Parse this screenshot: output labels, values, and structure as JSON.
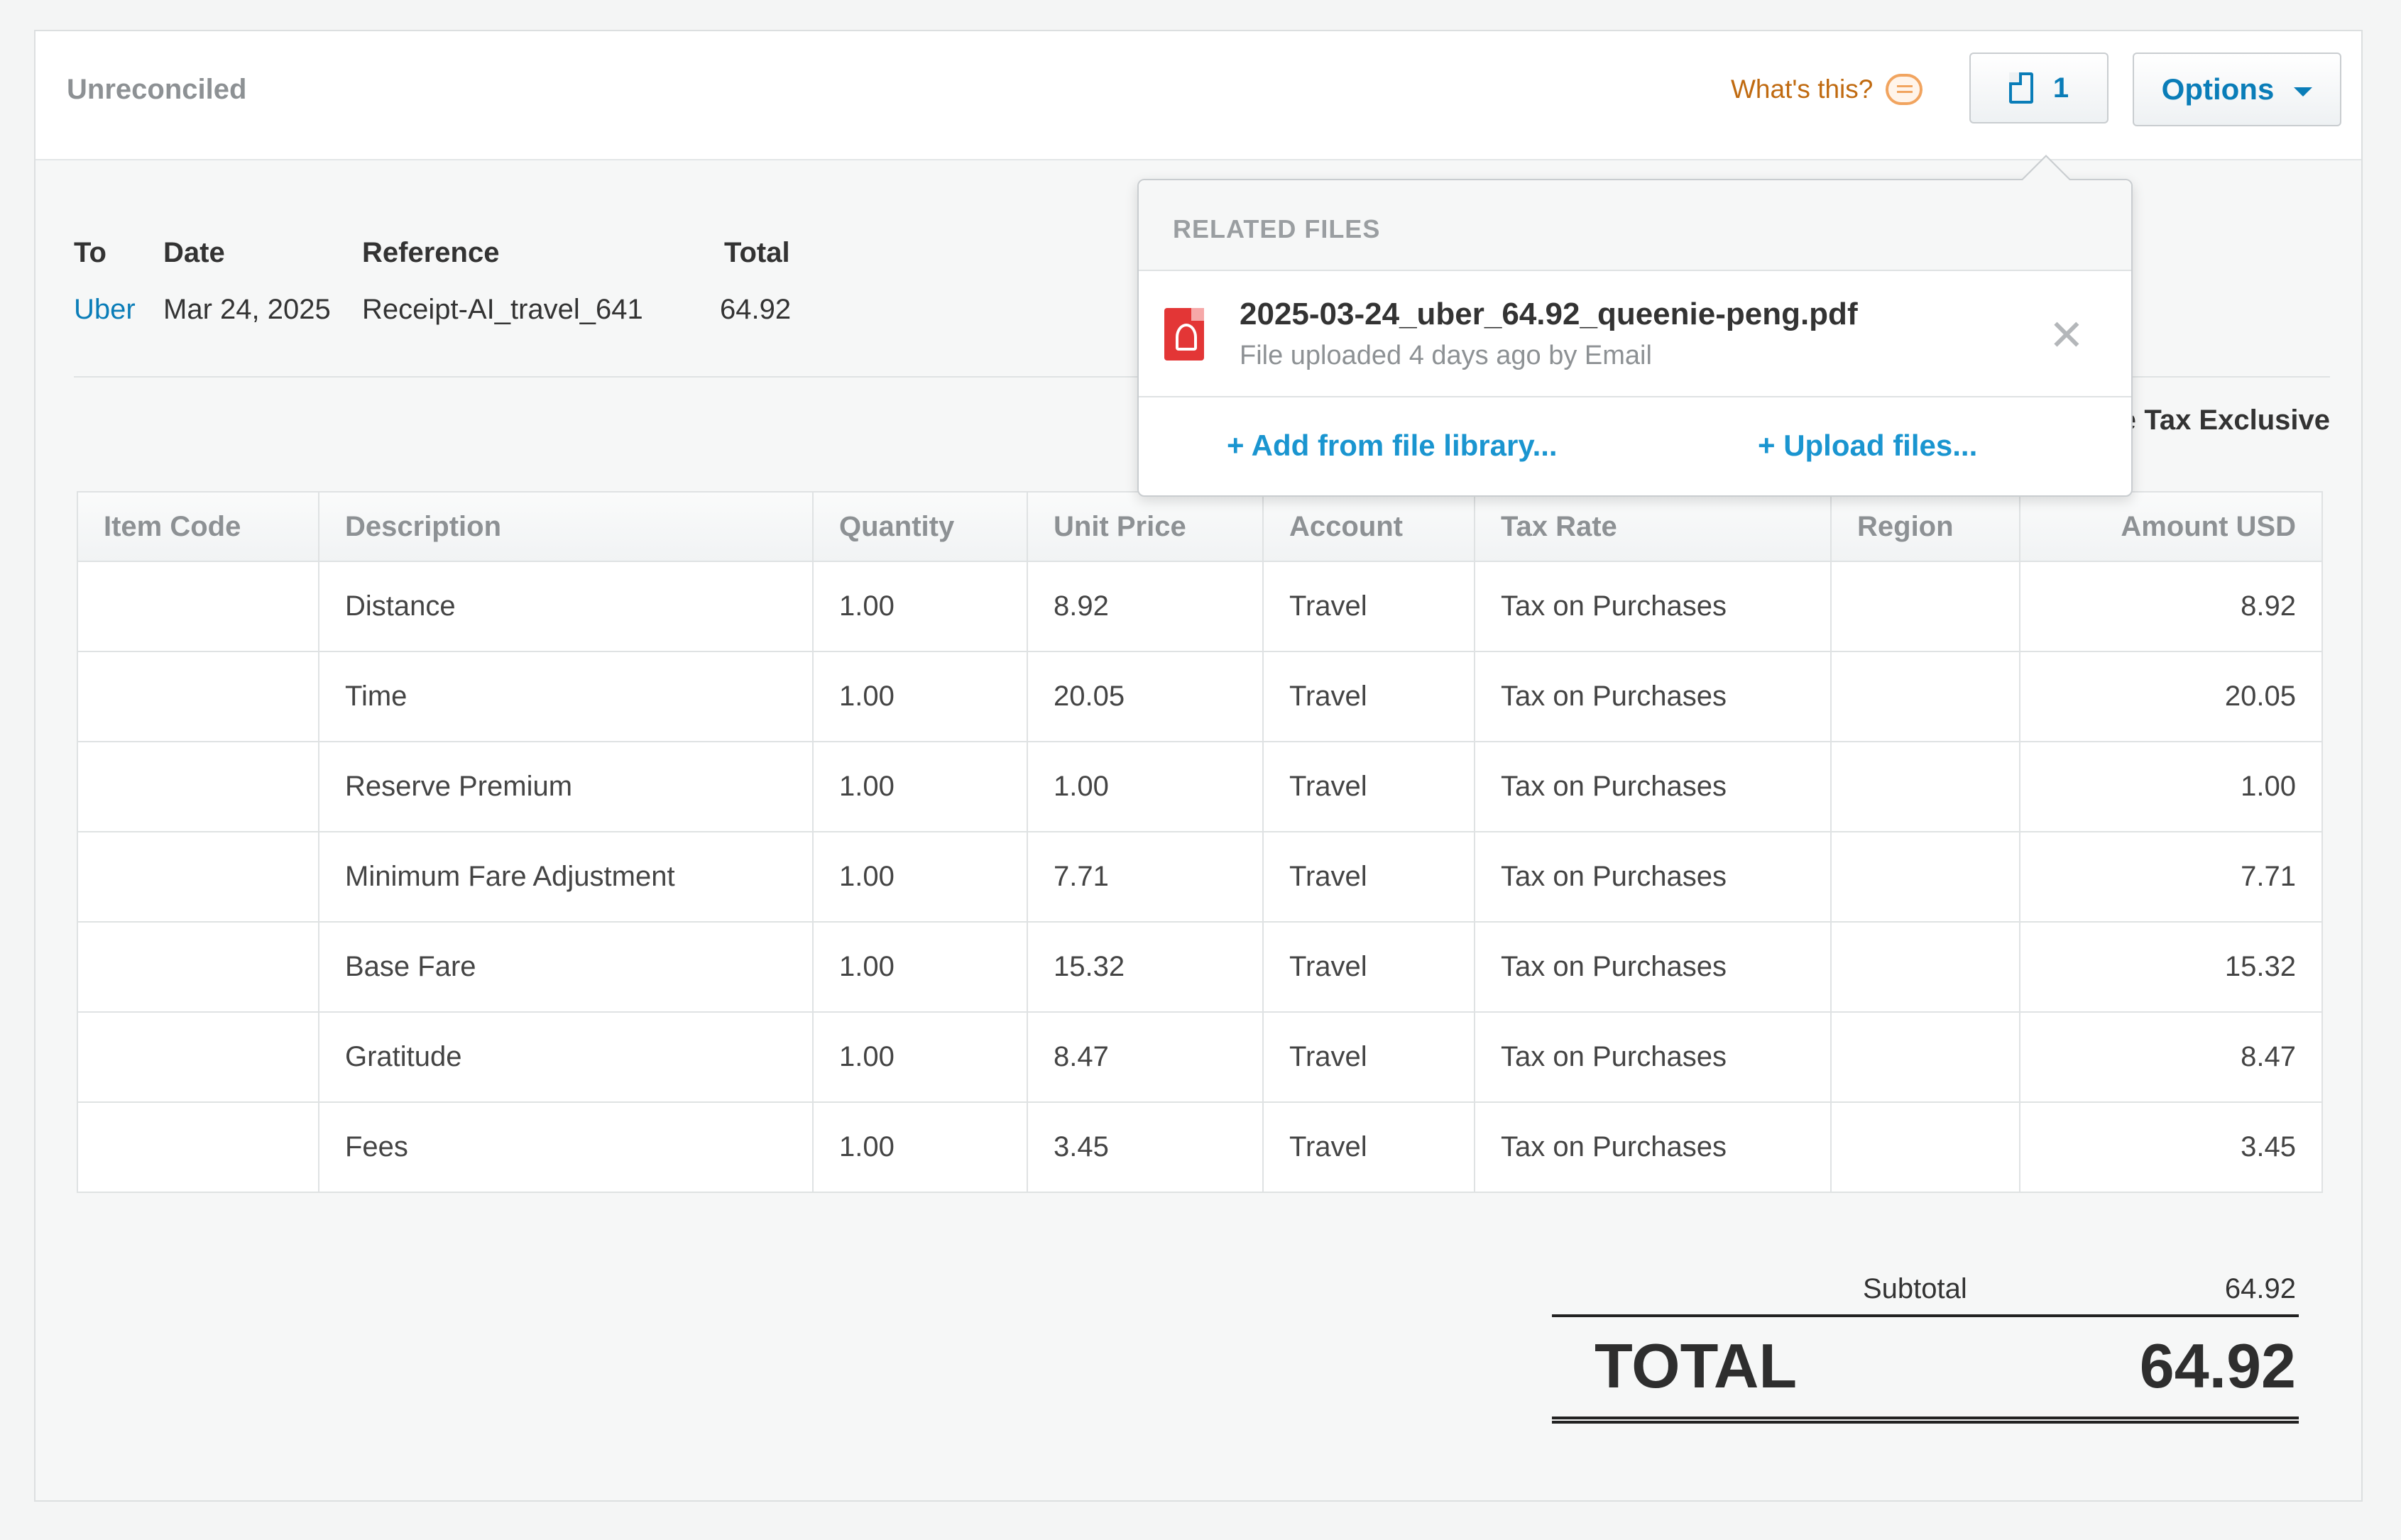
{
  "header": {
    "status": "Unreconciled",
    "whats_this": "What's this?",
    "files_count": "1",
    "options_label": "Options"
  },
  "summary": {
    "to_label": "To",
    "to_value": "Uber",
    "date_label": "Date",
    "date_value": "Mar 24, 2025",
    "reference_label": "Reference",
    "reference_value": "Receipt-AI_travel_641",
    "total_label": "Total",
    "total_value": "64.92"
  },
  "amounts_are": {
    "prefix": "re",
    "value": "Tax Exclusive"
  },
  "table": {
    "headers": [
      "Item Code",
      "Description",
      "Quantity",
      "Unit Price",
      "Account",
      "Tax Rate",
      "Region",
      "Amount USD"
    ],
    "rows": [
      {
        "item_code": "",
        "description": "Distance",
        "quantity": "1.00",
        "unit_price": "8.92",
        "account": "Travel",
        "tax_rate": "Tax on Purchases",
        "region": "",
        "amount": "8.92"
      },
      {
        "item_code": "",
        "description": "Time",
        "quantity": "1.00",
        "unit_price": "20.05",
        "account": "Travel",
        "tax_rate": "Tax on Purchases",
        "region": "",
        "amount": "20.05"
      },
      {
        "item_code": "",
        "description": "Reserve Premium",
        "quantity": "1.00",
        "unit_price": "1.00",
        "account": "Travel",
        "tax_rate": "Tax on Purchases",
        "region": "",
        "amount": "1.00"
      },
      {
        "item_code": "",
        "description": "Minimum Fare Adjustment",
        "quantity": "1.00",
        "unit_price": "7.71",
        "account": "Travel",
        "tax_rate": "Tax on Purchases",
        "region": "",
        "amount": "7.71"
      },
      {
        "item_code": "",
        "description": "Base Fare",
        "quantity": "1.00",
        "unit_price": "15.32",
        "account": "Travel",
        "tax_rate": "Tax on Purchases",
        "region": "",
        "amount": "15.32"
      },
      {
        "item_code": "",
        "description": "Gratitude",
        "quantity": "1.00",
        "unit_price": "8.47",
        "account": "Travel",
        "tax_rate": "Tax on Purchases",
        "region": "",
        "amount": "8.47"
      },
      {
        "item_code": "",
        "description": "Fees",
        "quantity": "1.00",
        "unit_price": "3.45",
        "account": "Travel",
        "tax_rate": "Tax on Purchases",
        "region": "",
        "amount": "3.45"
      }
    ]
  },
  "totals": {
    "subtotal_label": "Subtotal",
    "subtotal_value": "64.92",
    "total_label": "TOTAL",
    "total_value": "64.92"
  },
  "related_files": {
    "title": "RELATED FILES",
    "file_name": "2025-03-24_uber_64.92_queenie-peng.pdf",
    "file_meta": "File uploaded 4 days ago by Email",
    "add_from_library": "+ Add from file library...",
    "upload_files": "+ Upload files..."
  },
  "icons": {
    "whats_this": "speech-bubble-icon",
    "files": "document-icon",
    "options": "caret-down-icon",
    "file_type": "pdf-icon",
    "remove": "close-icon"
  },
  "colors": {
    "link": "#0a7db8",
    "whats_this": "#c06a10",
    "pdf": "#e33636"
  }
}
